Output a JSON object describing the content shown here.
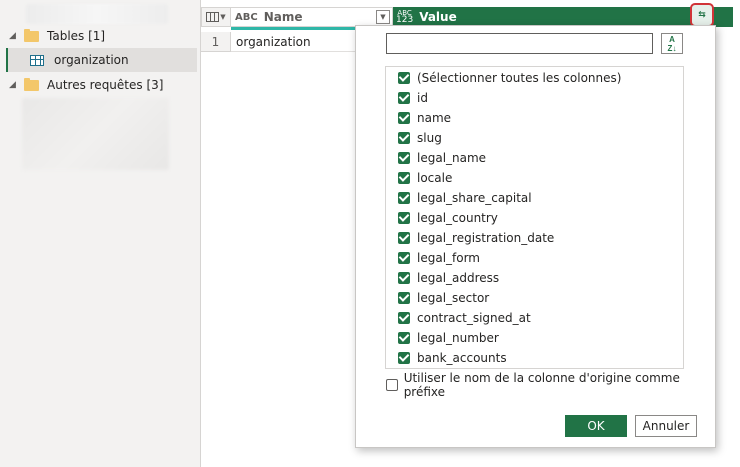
{
  "queries_pane": {
    "groups": [
      {
        "label": "Tables [1]"
      },
      {
        "label": "Autres requêtes [3]"
      }
    ],
    "items": [
      {
        "label": "organization"
      }
    ]
  },
  "grid": {
    "columns": [
      {
        "label": "Name",
        "type_icon": "ABC"
      },
      {
        "label": "Value",
        "type_icon_top": "ABC",
        "type_icon_bottom": "123"
      }
    ],
    "rows": [
      {
        "num": "1",
        "name": "organization"
      }
    ],
    "expand_icon": "expand-columns-icon"
  },
  "dialog": {
    "search": {
      "value": "",
      "placeholder": ""
    },
    "sort_icon_top": "A",
    "sort_icon_bottom": "Z",
    "columns": [
      {
        "label": "(Sélectionner toutes les colonnes)",
        "checked": true
      },
      {
        "label": "id",
        "checked": true
      },
      {
        "label": "name",
        "checked": true
      },
      {
        "label": "slug",
        "checked": true
      },
      {
        "label": "legal_name",
        "checked": true
      },
      {
        "label": "locale",
        "checked": true
      },
      {
        "label": "legal_share_capital",
        "checked": true
      },
      {
        "label": "legal_country",
        "checked": true
      },
      {
        "label": "legal_registration_date",
        "checked": true
      },
      {
        "label": "legal_form",
        "checked": true
      },
      {
        "label": "legal_address",
        "checked": true
      },
      {
        "label": "legal_sector",
        "checked": true
      },
      {
        "label": "contract_signed_at",
        "checked": true
      },
      {
        "label": "legal_number",
        "checked": true
      },
      {
        "label": "bank_accounts",
        "checked": true
      }
    ],
    "prefix_label": "Utiliser le nom de la colonne d'origine comme préfixe",
    "prefix_checked": false,
    "ok_label": "OK",
    "cancel_label": "Annuler"
  },
  "colors": {
    "accent": "#217346",
    "teal": "#2fb7a8",
    "highlight_border": "#d13438"
  }
}
